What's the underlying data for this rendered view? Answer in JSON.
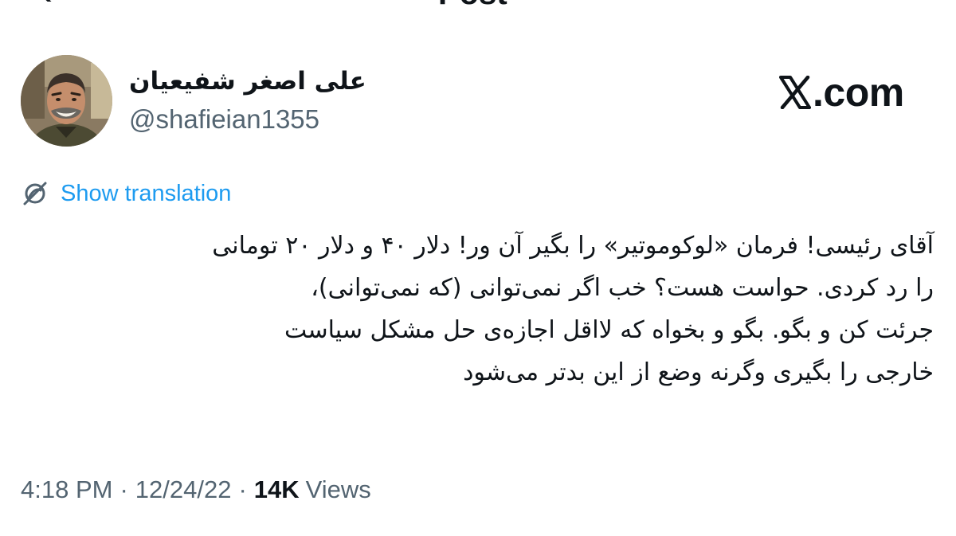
{
  "header": {
    "title": "Post"
  },
  "author": {
    "display_name": "علی اصغر شفیعیان",
    "handle": "@shafieian1355"
  },
  "watermark": {
    "text": ".com"
  },
  "translation": {
    "label": "Show translation"
  },
  "tweet": {
    "lines": [
      "آقای رئیسی! فرمان «لوکوموتیر» را بگیر آن ور! دلار ۴۰ و دلار ۲۰ تومانی",
      "را رد کردی. حواست هست؟ خب اگر نمی‌توانی (که نمی‌توانی)،",
      "جرئت کن و بگو. بگو و بخواه که لااقل اجازه‌ی حل مشکل سیاست",
      "خارجی را بگیری وگرنه وضع از این بدتر می‌شود"
    ]
  },
  "meta": {
    "time": "4:18 PM",
    "separator": "·",
    "date": "12/24/22",
    "views_count": "14K",
    "views_label": "Views"
  },
  "colors": {
    "link_blue": "#1d9bf0",
    "secondary_text": "#536471",
    "primary_text": "#0f1419"
  }
}
